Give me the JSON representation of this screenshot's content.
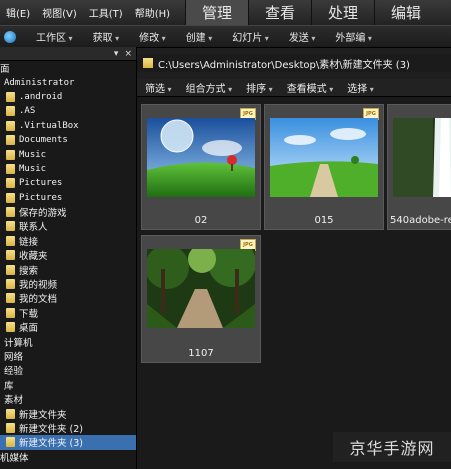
{
  "menubar": {
    "items": [
      "辑(E)",
      "视图(V)",
      "工具(T)",
      "帮助(H)"
    ]
  },
  "mode_tabs": [
    {
      "label": "管理",
      "active": true
    },
    {
      "label": "查看",
      "active": false
    },
    {
      "label": "处理",
      "active": false
    },
    {
      "label": "编辑",
      "active": false
    }
  ],
  "toolbar": {
    "items": [
      "工作区",
      "获取",
      "修改",
      "创建",
      "幻灯片",
      "发送",
      "外部编"
    ]
  },
  "sidebar": {
    "header_buttons": [
      "▾",
      "×"
    ],
    "tree": [
      {
        "label": "面",
        "folder": false,
        "mono": false,
        "indent": 0
      },
      {
        "label": "Administrator",
        "folder": false,
        "mono": true,
        "indent": 4
      },
      {
        "label": ".android",
        "folder": true,
        "mono": true,
        "indent": 6
      },
      {
        "label": ".AS",
        "folder": true,
        "mono": true,
        "indent": 6
      },
      {
        "label": ".VirtualBox",
        "folder": true,
        "mono": true,
        "indent": 6
      },
      {
        "label": "Documents",
        "folder": true,
        "mono": true,
        "indent": 6
      },
      {
        "label": "Music",
        "folder": true,
        "mono": true,
        "indent": 6
      },
      {
        "label": "Music",
        "folder": true,
        "mono": true,
        "indent": 6
      },
      {
        "label": "Pictures",
        "folder": true,
        "mono": true,
        "indent": 6
      },
      {
        "label": "Pictures",
        "folder": true,
        "mono": true,
        "indent": 6
      },
      {
        "label": "保存的游戏",
        "folder": true,
        "mono": false,
        "indent": 6
      },
      {
        "label": "联系人",
        "folder": true,
        "mono": false,
        "indent": 6
      },
      {
        "label": "链接",
        "folder": true,
        "mono": false,
        "indent": 6
      },
      {
        "label": "收藏夹",
        "folder": true,
        "mono": false,
        "indent": 6
      },
      {
        "label": "搜索",
        "folder": true,
        "mono": false,
        "indent": 6
      },
      {
        "label": "我的视频",
        "folder": true,
        "mono": false,
        "indent": 6
      },
      {
        "label": "我的文档",
        "folder": true,
        "mono": false,
        "indent": 6
      },
      {
        "label": "下载",
        "folder": true,
        "mono": false,
        "indent": 6
      },
      {
        "label": "桌面",
        "folder": true,
        "mono": false,
        "indent": 6
      },
      {
        "label": "计算机",
        "folder": false,
        "mono": false,
        "indent": 4
      },
      {
        "label": "网络",
        "folder": false,
        "mono": false,
        "indent": 4
      },
      {
        "label": "经验",
        "folder": false,
        "mono": false,
        "indent": 4
      },
      {
        "label": "库",
        "folder": false,
        "mono": false,
        "indent": 4
      },
      {
        "label": "素材",
        "folder": false,
        "mono": false,
        "indent": 4
      },
      {
        "label": "新建文件夹",
        "folder": true,
        "mono": false,
        "indent": 6
      },
      {
        "label": "新建文件夹 (2)",
        "folder": true,
        "mono": false,
        "indent": 6
      },
      {
        "label": "新建文件夹 (3)",
        "folder": true,
        "mono": false,
        "indent": 6,
        "selected": true
      },
      {
        "label": "机媒体",
        "folder": false,
        "mono": false,
        "indent": 0
      }
    ]
  },
  "path": {
    "text": "C:\\Users\\Administrator\\Desktop\\素材\\新建文件夹 (3)"
  },
  "filterbar": {
    "items": [
      "筛选",
      "组合方式",
      "排序",
      "查看模式",
      "选择"
    ]
  },
  "thumbnails": [
    {
      "label": "02",
      "badge": "JPG",
      "scene": "planet"
    },
    {
      "label": "015",
      "badge": "JPG",
      "scene": "road"
    },
    {
      "label": "540adobe-re",
      "badge": "",
      "scene": "waterfall"
    },
    {
      "label": "1107",
      "badge": "JPG",
      "scene": "forest"
    }
  ],
  "watermark": {
    "text": "京华手游网"
  }
}
